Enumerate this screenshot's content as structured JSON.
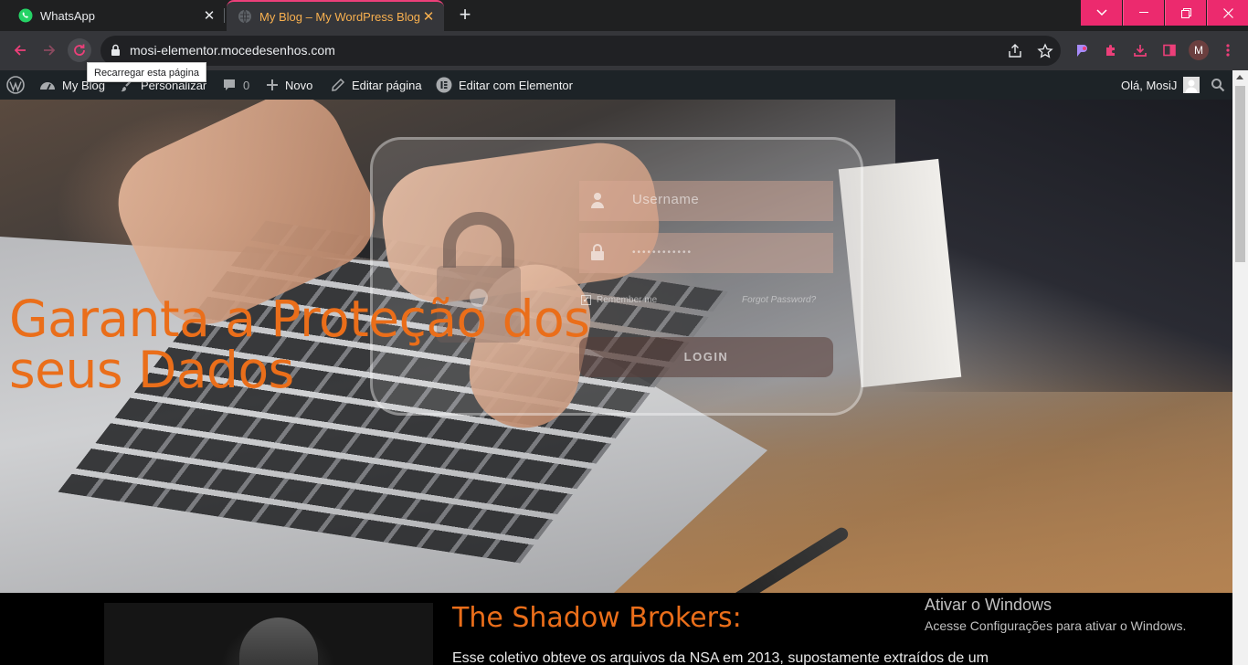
{
  "browser": {
    "tabs": [
      {
        "title": "WhatsApp",
        "favicon": "whatsapp-icon",
        "active": false
      },
      {
        "title": "My Blog – My WordPress Blog",
        "favicon": "globe-icon",
        "active": true
      }
    ],
    "url": "mosi-elementor.mocedesenhos.com",
    "tooltip": "Recarregar esta página",
    "profile_initial": "M",
    "accent_color": "#ec2a6e"
  },
  "admin_bar": {
    "site_name": "My Blog",
    "customize": "Personalizar",
    "comments_count": "0",
    "new": "Novo",
    "edit_page": "Editar página",
    "edit_elementor": "Editar com Elementor",
    "greeting": "Olá, MosiJ"
  },
  "hero": {
    "heading": "Garanta a Proteção dos seus Dados",
    "login": {
      "username_placeholder": "Username",
      "password_mask": "••••••••••••",
      "remember_label": "Remember me",
      "forgot_label": "Forgot Password?",
      "button_label": "LOGIN"
    }
  },
  "section": {
    "title": "The Shadow Brokers:",
    "paragraph": "Esse coletivo obteve os arquivos da NSA em 2013, supostamente extraídos de um"
  },
  "watermark": {
    "title": "Ativar o Windows",
    "subtitle": "Acesse Configurações para ativar o Windows."
  }
}
